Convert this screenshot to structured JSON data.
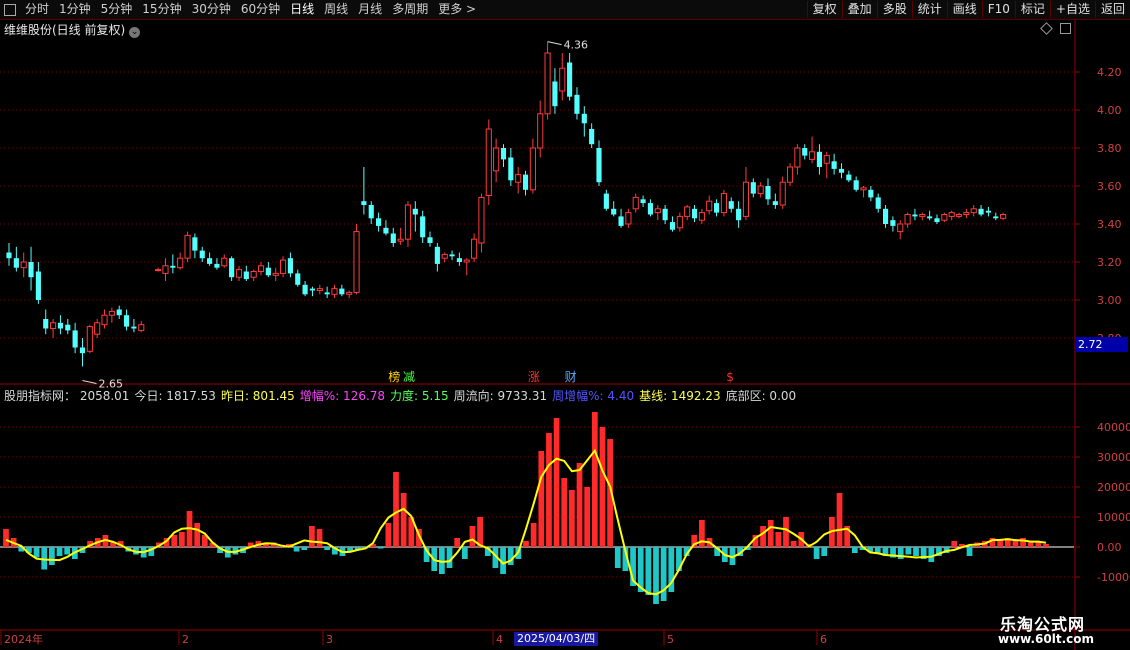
{
  "toolbar": {
    "periods": [
      "分时",
      "1分钟",
      "5分钟",
      "15分钟",
      "30分钟",
      "60分钟",
      "日线",
      "周线",
      "月线",
      "多周期",
      "更多 >"
    ],
    "active_period": "日线",
    "buttons": [
      "复权",
      "叠加",
      "多股",
      "统计",
      "画线",
      "F10",
      "标记",
      "+自选",
      "返回"
    ]
  },
  "stock_title": "维维股份(日线 前复权)",
  "current_price_tag": "2.72",
  "chart_data": [
    {
      "type": "candlestick",
      "title": "维维股份(日线 前复权)",
      "ylim": [
        2.72,
        4.42
      ],
      "y_ticks": [
        "4.20",
        "4.00",
        "3.80",
        "3.60",
        "3.40",
        "3.20",
        "3.00",
        "2.80"
      ],
      "annotations": [
        {
          "text": "4.36",
          "value": 4.36
        },
        {
          "text": "2.65",
          "value": 2.65
        }
      ],
      "event_markers": [
        "榜",
        "减",
        "涨",
        "财",
        "$"
      ],
      "colors": {
        "up": "#ff3b3b",
        "down": "#54ffff"
      },
      "candles": [
        [
          3.25,
          3.3,
          3.18,
          3.22
        ],
        [
          3.22,
          3.28,
          3.15,
          3.17
        ],
        [
          3.17,
          3.25,
          3.12,
          3.2
        ],
        [
          3.2,
          3.28,
          3.05,
          3.12
        ],
        [
          3.15,
          3.2,
          2.98,
          3.0
        ],
        [
          2.9,
          2.95,
          2.82,
          2.85
        ],
        [
          2.85,
          2.9,
          2.8,
          2.88
        ],
        [
          2.88,
          2.92,
          2.82,
          2.85
        ],
        [
          2.87,
          2.9,
          2.82,
          2.84
        ],
        [
          2.84,
          2.88,
          2.72,
          2.75
        ],
        [
          2.75,
          2.8,
          2.65,
          2.72
        ],
        [
          2.73,
          2.87,
          2.72,
          2.86
        ],
        [
          2.82,
          2.9,
          2.8,
          2.88
        ],
        [
          2.87,
          2.95,
          2.85,
          2.92
        ],
        [
          2.92,
          2.96,
          2.88,
          2.94
        ],
        [
          2.95,
          2.97,
          2.9,
          2.92
        ],
        [
          2.92,
          2.95,
          2.84,
          2.86
        ],
        [
          2.86,
          2.9,
          2.83,
          2.85
        ],
        [
          2.84,
          2.89,
          2.83,
          2.87
        ],
        [
          3.16,
          3.17,
          3.15,
          3.16
        ],
        [
          3.14,
          3.22,
          3.1,
          3.18
        ],
        [
          3.18,
          3.24,
          3.14,
          3.17
        ],
        [
          3.17,
          3.25,
          3.16,
          3.22
        ],
        [
          3.22,
          3.36,
          3.2,
          3.34
        ],
        [
          3.33,
          3.35,
          3.22,
          3.26
        ],
        [
          3.26,
          3.28,
          3.2,
          3.22
        ],
        [
          3.22,
          3.25,
          3.18,
          3.19
        ],
        [
          3.19,
          3.22,
          3.16,
          3.17
        ],
        [
          3.18,
          3.24,
          3.17,
          3.22
        ],
        [
          3.22,
          3.23,
          3.1,
          3.12
        ],
        [
          3.12,
          3.18,
          3.1,
          3.16
        ],
        [
          3.15,
          3.18,
          3.1,
          3.11
        ],
        [
          3.12,
          3.16,
          3.1,
          3.15
        ],
        [
          3.15,
          3.2,
          3.13,
          3.18
        ],
        [
          3.17,
          3.2,
          3.12,
          3.13
        ],
        [
          3.13,
          3.17,
          3.1,
          3.14
        ],
        [
          3.14,
          3.23,
          3.12,
          3.21
        ],
        [
          3.22,
          3.25,
          3.12,
          3.14
        ],
        [
          3.14,
          3.16,
          3.07,
          3.08
        ],
        [
          3.08,
          3.1,
          3.02,
          3.03
        ],
        [
          3.06,
          3.07,
          3.02,
          3.05
        ],
        [
          3.05,
          3.08,
          3.03,
          3.06
        ],
        [
          3.04,
          3.07,
          3.01,
          3.03
        ],
        [
          3.03,
          3.08,
          3.01,
          3.06
        ],
        [
          3.06,
          3.08,
          3.02,
          3.03
        ],
        [
          3.03,
          3.05,
          3.01,
          3.04
        ],
        [
          3.04,
          3.4,
          3.03,
          3.36
        ],
        [
          3.52,
          3.7,
          3.45,
          3.5
        ],
        [
          3.5,
          3.52,
          3.4,
          3.43
        ],
        [
          3.43,
          3.46,
          3.36,
          3.39
        ],
        [
          3.38,
          3.42,
          3.34,
          3.35
        ],
        [
          3.35,
          3.38,
          3.28,
          3.3
        ],
        [
          3.31,
          3.38,
          3.29,
          3.32
        ],
        [
          3.32,
          3.52,
          3.28,
          3.5
        ],
        [
          3.48,
          3.52,
          3.36,
          3.45
        ],
        [
          3.44,
          3.47,
          3.3,
          3.33
        ],
        [
          3.33,
          3.36,
          3.28,
          3.3
        ],
        [
          3.28,
          3.3,
          3.15,
          3.19
        ],
        [
          3.22,
          3.25,
          3.2,
          3.24
        ],
        [
          3.24,
          3.26,
          3.21,
          3.23
        ],
        [
          3.22,
          3.25,
          3.18,
          3.2
        ],
        [
          3.2,
          3.22,
          3.13,
          3.21
        ],
        [
          3.22,
          3.35,
          3.2,
          3.32
        ],
        [
          3.3,
          3.56,
          3.25,
          3.54
        ],
        [
          3.55,
          3.95,
          3.5,
          3.9
        ],
        [
          3.68,
          3.85,
          3.62,
          3.8
        ],
        [
          3.8,
          3.82,
          3.7,
          3.74
        ],
        [
          3.75,
          3.8,
          3.6,
          3.63
        ],
        [
          3.62,
          3.7,
          3.56,
          3.66
        ],
        [
          3.66,
          3.68,
          3.55,
          3.58
        ],
        [
          3.58,
          3.85,
          3.56,
          3.8
        ],
        [
          3.8,
          4.05,
          3.75,
          3.98
        ],
        [
          3.98,
          4.36,
          3.95,
          4.3
        ],
        [
          4.15,
          4.22,
          3.98,
          4.02
        ],
        [
          4.1,
          4.3,
          4.05,
          4.22
        ],
        [
          4.25,
          4.3,
          4.05,
          4.07
        ],
        [
          4.08,
          4.12,
          3.95,
          3.98
        ],
        [
          3.98,
          4.02,
          3.86,
          3.93
        ],
        [
          3.9,
          3.93,
          3.8,
          3.82
        ],
        [
          3.8,
          3.84,
          3.6,
          3.62
        ],
        [
          3.56,
          3.58,
          3.47,
          3.48
        ],
        [
          3.48,
          3.52,
          3.44,
          3.45
        ],
        [
          3.44,
          3.48,
          3.38,
          3.39
        ],
        [
          3.4,
          3.48,
          3.38,
          3.46
        ],
        [
          3.48,
          3.56,
          3.46,
          3.54
        ],
        [
          3.53,
          3.55,
          3.49,
          3.51
        ],
        [
          3.51,
          3.53,
          3.44,
          3.45
        ],
        [
          3.46,
          3.5,
          3.42,
          3.48
        ],
        [
          3.48,
          3.5,
          3.4,
          3.42
        ],
        [
          3.41,
          3.44,
          3.36,
          3.37
        ],
        [
          3.38,
          3.46,
          3.36,
          3.44
        ],
        [
          3.44,
          3.5,
          3.42,
          3.49
        ],
        [
          3.48,
          3.5,
          3.41,
          3.43
        ],
        [
          3.42,
          3.48,
          3.4,
          3.46
        ],
        [
          3.47,
          3.55,
          3.45,
          3.52
        ],
        [
          3.51,
          3.53,
          3.44,
          3.46
        ],
        [
          3.46,
          3.58,
          3.44,
          3.56
        ],
        [
          3.52,
          3.54,
          3.46,
          3.48
        ],
        [
          3.48,
          3.52,
          3.38,
          3.42
        ],
        [
          3.44,
          3.7,
          3.42,
          3.62
        ],
        [
          3.62,
          3.64,
          3.54,
          3.56
        ],
        [
          3.56,
          3.62,
          3.54,
          3.6
        ],
        [
          3.6,
          3.64,
          3.5,
          3.53
        ],
        [
          3.52,
          3.56,
          3.48,
          3.5
        ],
        [
          3.5,
          3.65,
          3.48,
          3.62
        ],
        [
          3.62,
          3.72,
          3.6,
          3.7
        ],
        [
          3.7,
          3.82,
          3.66,
          3.8
        ],
        [
          3.8,
          3.82,
          3.74,
          3.76
        ],
        [
          3.74,
          3.86,
          3.72,
          3.78
        ],
        [
          3.78,
          3.82,
          3.66,
          3.7
        ],
        [
          3.72,
          3.78,
          3.64,
          3.76
        ],
        [
          3.73,
          3.77,
          3.66,
          3.69
        ],
        [
          3.69,
          3.72,
          3.64,
          3.67
        ],
        [
          3.66,
          3.68,
          3.62,
          3.63
        ],
        [
          3.63,
          3.65,
          3.57,
          3.58
        ],
        [
          3.58,
          3.6,
          3.54,
          3.59
        ],
        [
          3.58,
          3.6,
          3.52,
          3.54
        ],
        [
          3.54,
          3.56,
          3.46,
          3.48
        ],
        [
          3.48,
          3.5,
          3.38,
          3.4
        ],
        [
          3.42,
          3.44,
          3.36,
          3.39
        ],
        [
          3.36,
          3.42,
          3.32,
          3.4
        ],
        [
          3.4,
          3.46,
          3.38,
          3.45
        ],
        [
          3.45,
          3.48,
          3.42,
          3.44
        ],
        [
          3.44,
          3.46,
          3.42,
          3.45
        ],
        [
          3.44,
          3.47,
          3.42,
          3.43
        ],
        [
          3.43,
          3.45,
          3.4,
          3.41
        ],
        [
          3.42,
          3.46,
          3.41,
          3.45
        ],
        [
          3.44,
          3.47,
          3.42,
          3.46
        ],
        [
          3.44,
          3.46,
          3.43,
          3.45
        ],
        [
          3.45,
          3.48,
          3.43,
          3.46
        ],
        [
          3.46,
          3.5,
          3.44,
          3.48
        ],
        [
          3.48,
          3.5,
          3.44,
          3.45
        ],
        [
          3.47,
          3.49,
          3.44,
          3.46
        ],
        [
          3.44,
          3.46,
          3.42,
          3.43
        ],
        [
          3.43,
          3.46,
          3.42,
          3.45
        ]
      ]
    },
    {
      "type": "bar",
      "title": "股朋指标网",
      "ylim": [
        -20000,
        50000
      ],
      "y_ticks": [
        "40000",
        "30000",
        "20000",
        "10000",
        "0.00",
        "-10000"
      ],
      "x_tick_labels": [
        "2024年",
        "2",
        "3",
        "4",
        "5",
        "6"
      ],
      "highlighted_date": "2025/04/03/四",
      "indicator_line_color": "#ffff00",
      "bar_colors": {
        "positive": "#ff2a2a",
        "negative": "#1fc8c8"
      },
      "values": [
        6000,
        3000,
        -1500,
        -2000,
        -3500,
        -7500,
        -6000,
        -3000,
        -2500,
        -4000,
        -2000,
        2000,
        3000,
        4000,
        1500,
        2000,
        -1500,
        -2500,
        -3500,
        -3000,
        1500,
        3000,
        4000,
        5000,
        12000,
        8000,
        4000,
        1500,
        -2000,
        -3500,
        -2500,
        -2000,
        1500,
        2000,
        1000,
        1500,
        500,
        1000,
        -1500,
        -1000,
        7000,
        6000,
        -1000,
        -2500,
        -3000,
        -1500,
        -1000,
        -500,
        1000,
        -500,
        8000,
        25000,
        18000,
        10000,
        6000,
        -5000,
        -8000,
        -9000,
        -7000,
        3000,
        -4000,
        7000,
        10000,
        -3000,
        -7000,
        -9000,
        -6000,
        -4000,
        2000,
        8000,
        32000,
        38000,
        43000,
        23000,
        19000,
        28000,
        20000,
        45000,
        40000,
        36000,
        -7000,
        -8000,
        -13000,
        -15000,
        -16000,
        -19000,
        -18000,
        -15000,
        -8000,
        -3000,
        4000,
        9000,
        3000,
        -3000,
        -5000,
        -6000,
        -3000,
        -1000,
        4000,
        7000,
        9000,
        5000,
        10000,
        2000,
        5000,
        1000,
        -4000,
        -3000,
        10000,
        18000,
        7000,
        -2000,
        -1000,
        -1500,
        -2000,
        -3000,
        -3500,
        -4000,
        -2500,
        -3000,
        -4000,
        -5000,
        -3000,
        -2000,
        2000,
        1000,
        -3000,
        1500,
        2000,
        3000,
        2500,
        3000,
        2000,
        3000,
        1500,
        2000,
        1000
      ],
      "stats": [
        {
          "label": "股朋指标网",
          "value": "2058.01",
          "color": "#d8d8d8"
        },
        {
          "label": "今日",
          "value": "1817.53",
          "color": "#d8d8d8"
        },
        {
          "label": "昨日",
          "value": "801.45",
          "color": "#ffff55"
        },
        {
          "label": "增幅%",
          "value": "126.78",
          "color": "#ff44ff"
        },
        {
          "label": "力度",
          "value": "5.15",
          "color": "#55ff55"
        },
        {
          "label": "周流向",
          "value": "9733.31",
          "color": "#d8d8d8"
        },
        {
          "label": "周增幅%",
          "value": "4.40",
          "color": "#5555ff"
        },
        {
          "label": "基线",
          "value": "1492.23",
          "color": "#ffff55"
        },
        {
          "label": "底部区",
          "value": "0.00",
          "color": "#d8d8d8"
        }
      ]
    }
  ],
  "watermark": {
    "line1": "乐淘公式网",
    "line2": "www.60lt.com"
  }
}
